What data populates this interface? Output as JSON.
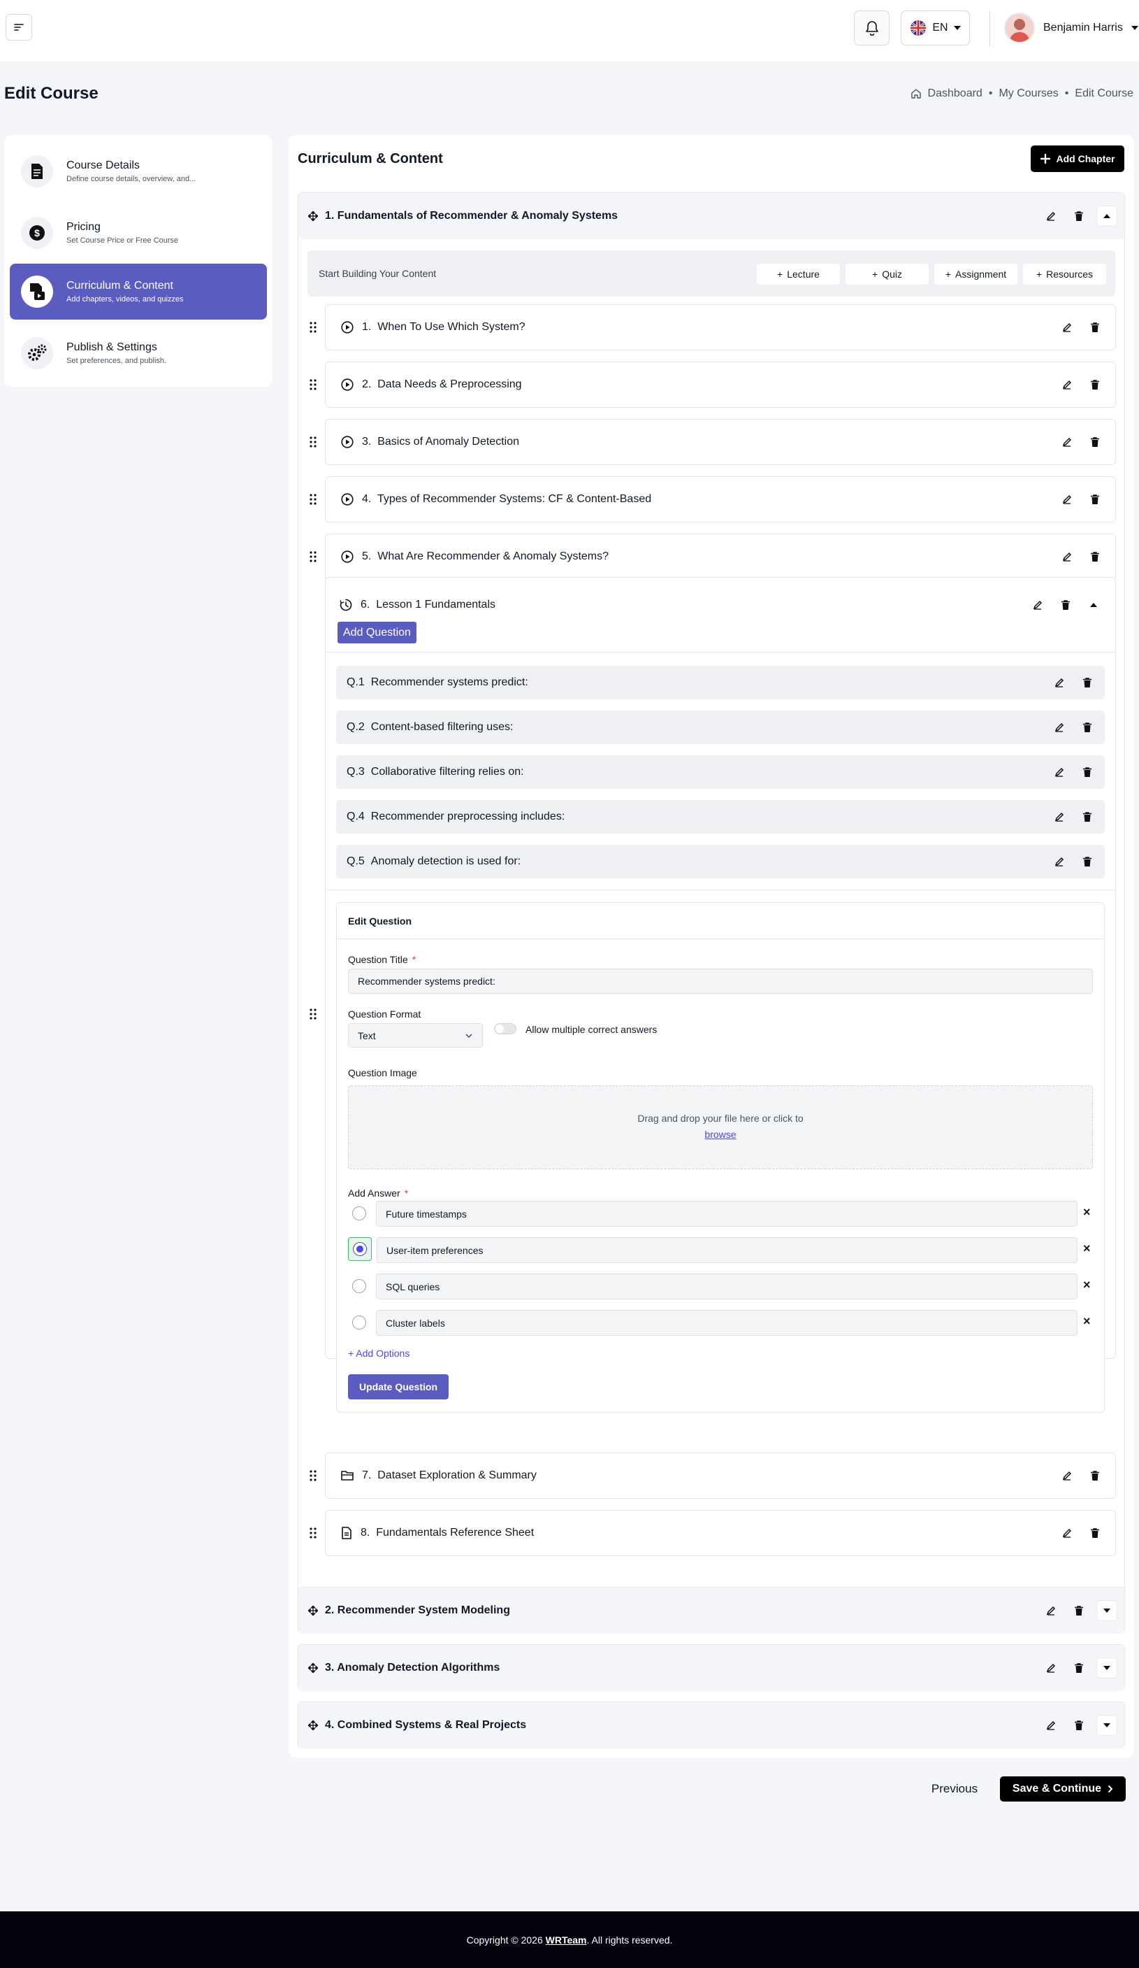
{
  "header": {
    "language": "EN",
    "user_name": "Benjamin Harris"
  },
  "page": {
    "title": "Edit Course",
    "breadcrumb": [
      "Dashboard",
      "My Courses",
      "Edit Course"
    ]
  },
  "steps": [
    {
      "title": "Course Details",
      "subtitle": "Define course details, overview, and...",
      "icon": "document-icon"
    },
    {
      "title": "Pricing",
      "subtitle": "Set Course Price or Free Course",
      "icon": "dollar-icon"
    },
    {
      "title": "Curriculum & Content",
      "subtitle": "Add chapters, videos, and quizzes",
      "icon": "video-file-icon"
    },
    {
      "title": "Publish & Settings",
      "subtitle": "Set preferences, and publish.",
      "icon": "gears-icon"
    }
  ],
  "curriculum": {
    "title": "Curriculum & Content",
    "add_chapter_label": "Add Chapter",
    "start_building_label": "Start Building Your Content",
    "builder_buttons": [
      "Lecture",
      "Quiz",
      "Assignment",
      "Resources"
    ]
  },
  "chapters": [
    {
      "title": "1. Fundamentals of Recommender & Anomaly Systems"
    },
    {
      "title": "2. Recommender System Modeling"
    },
    {
      "title": "3. Anomaly Detection Algorithms"
    },
    {
      "title": "4. Combined Systems & Real Projects"
    }
  ],
  "lessons": [
    {
      "number": "1.",
      "title": "When To Use Which System?",
      "icon": "play-circle-icon"
    },
    {
      "number": "2.",
      "title": "Data Needs & Preprocessing",
      "icon": "play-circle-icon"
    },
    {
      "number": "3.",
      "title": "Basics of Anomaly Detection",
      "icon": "play-circle-icon"
    },
    {
      "number": "4.",
      "title": "Types of Recommender Systems: CF & Content-Based",
      "icon": "play-circle-icon"
    },
    {
      "number": "5.",
      "title": "What Are Recommender & Anomaly Systems?",
      "icon": "play-circle-icon"
    },
    {
      "number": "6.",
      "title": "Lesson 1 Fundamentals",
      "icon": "quiz-timer-icon"
    },
    {
      "number": "7.",
      "title": "Dataset Exploration & Summary",
      "icon": "folder-icon"
    },
    {
      "number": "8.",
      "title": "Fundamentals Reference Sheet",
      "icon": "file-icon"
    }
  ],
  "quiz": {
    "add_question_label": "Add Question",
    "questions": [
      {
        "number": "Q.1",
        "title": "Recommender systems predict:"
      },
      {
        "number": "Q.2",
        "title": "Content-based filtering uses:"
      },
      {
        "number": "Q.3",
        "title": "Collaborative filtering relies on:"
      },
      {
        "number": "Q.4",
        "title": "Recommender preprocessing includes:"
      },
      {
        "number": "Q.5",
        "title": "Anomaly detection is used for:"
      }
    ]
  },
  "edit_question": {
    "heading": "Edit Question",
    "title_label": "Question Title",
    "title_value": "Recommender systems predict:",
    "format_label": "Question Format",
    "format_value": "Text",
    "multiple_label": "Allow multiple correct answers",
    "multiple_enabled": false,
    "image_label": "Question Image",
    "dropzone_text": "Drag and drop your file here or click to",
    "browse_label": "browse",
    "answer_label": "Add Answer",
    "answers": [
      {
        "text": "Future timestamps",
        "correct": false
      },
      {
        "text": "User-item preferences",
        "correct": true
      },
      {
        "text": "SQL queries",
        "correct": false
      },
      {
        "text": "Cluster labels",
        "correct": false
      }
    ],
    "add_options_label": "Add Options",
    "update_label": "Update Question"
  },
  "nav": {
    "previous_label": "Previous",
    "save_label": "Save & Continue"
  },
  "footer": {
    "prefix": "Copyright © 2026 ",
    "brand": "WRTeam",
    "suffix": ". All rights reserved."
  },
  "colors": {
    "accent": "#5b5cbf",
    "dark": "#000000",
    "footer_bg": "#03030d"
  }
}
